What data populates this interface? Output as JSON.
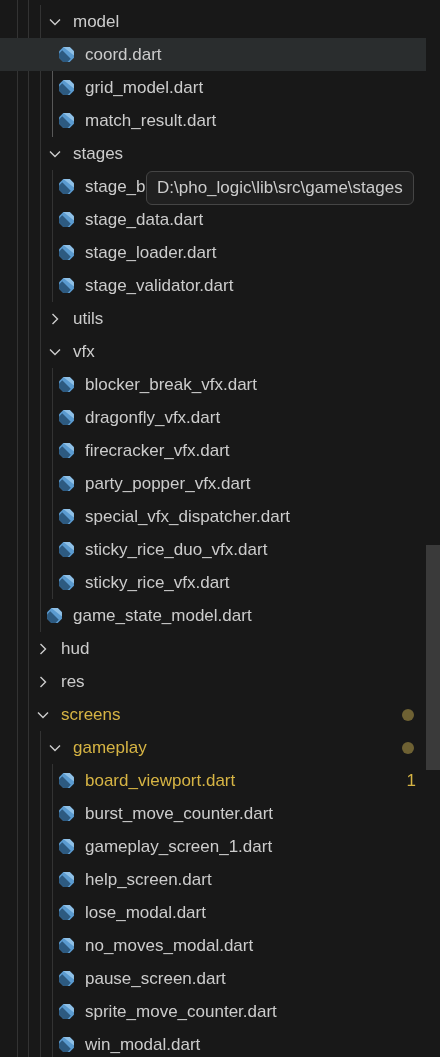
{
  "explorer": {
    "items": [
      {
        "kind": "folder",
        "expanded": true,
        "children": [
          {
            "kind": "folder",
            "name": "model",
            "expanded": true,
            "children": [
              {
                "kind": "file",
                "name": "coord.dart",
                "selected": true
              },
              {
                "kind": "file",
                "name": "grid_model.dart",
                "selected": false
              },
              {
                "kind": "file",
                "name": "match_result.dart",
                "selected": false
              }
            ]
          },
          {
            "kind": "folder",
            "name": "stages",
            "expanded": true,
            "children": [
              {
                "kind": "file",
                "name": "stage_b",
                "selected": false
              },
              {
                "kind": "file",
                "name": "stage_data.dart",
                "selected": false
              },
              {
                "kind": "file",
                "name": "stage_loader.dart",
                "selected": false
              },
              {
                "kind": "file",
                "name": "stage_validator.dart",
                "selected": false
              }
            ]
          },
          {
            "kind": "folder",
            "name": "utils",
            "expanded": false
          },
          {
            "kind": "folder",
            "name": "vfx",
            "expanded": true,
            "children": [
              {
                "kind": "file",
                "name": "blocker_break_vfx.dart",
                "selected": false
              },
              {
                "kind": "file",
                "name": "dragonfly_vfx.dart",
                "selected": false
              },
              {
                "kind": "file",
                "name": "firecracker_vfx.dart",
                "selected": false
              },
              {
                "kind": "file",
                "name": "party_popper_vfx.dart",
                "selected": false
              },
              {
                "kind": "file",
                "name": "special_vfx_dispatcher.dart",
                "selected": false
              },
              {
                "kind": "file",
                "name": "sticky_rice_duo_vfx.dart",
                "selected": false
              },
              {
                "kind": "file",
                "name": "sticky_rice_vfx.dart",
                "selected": false
              }
            ]
          },
          {
            "kind": "file",
            "name": "game_state_model.dart",
            "selected": false
          }
        ]
      },
      {
        "kind": "folder",
        "name": "hud",
        "expanded": false
      },
      {
        "kind": "folder",
        "name": "res",
        "expanded": false
      },
      {
        "kind": "folder",
        "name": "screens",
        "expanded": true,
        "modified": true,
        "children": [
          {
            "kind": "folder",
            "name": "gameplay",
            "expanded": true,
            "modified": true,
            "children": [
              {
                "kind": "file",
                "name": "board_viewport.dart",
                "selected": false,
                "modified": true,
                "badge": "1"
              },
              {
                "kind": "file",
                "name": "burst_move_counter.dart",
                "selected": false
              },
              {
                "kind": "file",
                "name": "gameplay_screen_1.dart",
                "selected": false
              },
              {
                "kind": "file",
                "name": "help_screen.dart",
                "selected": false
              },
              {
                "kind": "file",
                "name": "lose_modal.dart",
                "selected": false
              },
              {
                "kind": "file",
                "name": "no_moves_modal.dart",
                "selected": false
              },
              {
                "kind": "file",
                "name": "pause_screen.dart",
                "selected": false
              },
              {
                "kind": "file",
                "name": "sprite_move_counter.dart",
                "selected": false
              },
              {
                "kind": "file",
                "name": "win_modal.dart",
                "selected": false
              }
            ]
          }
        ]
      }
    ]
  },
  "tooltip": {
    "text": "D:\\pho_logic\\lib\\src\\game\\stages"
  }
}
